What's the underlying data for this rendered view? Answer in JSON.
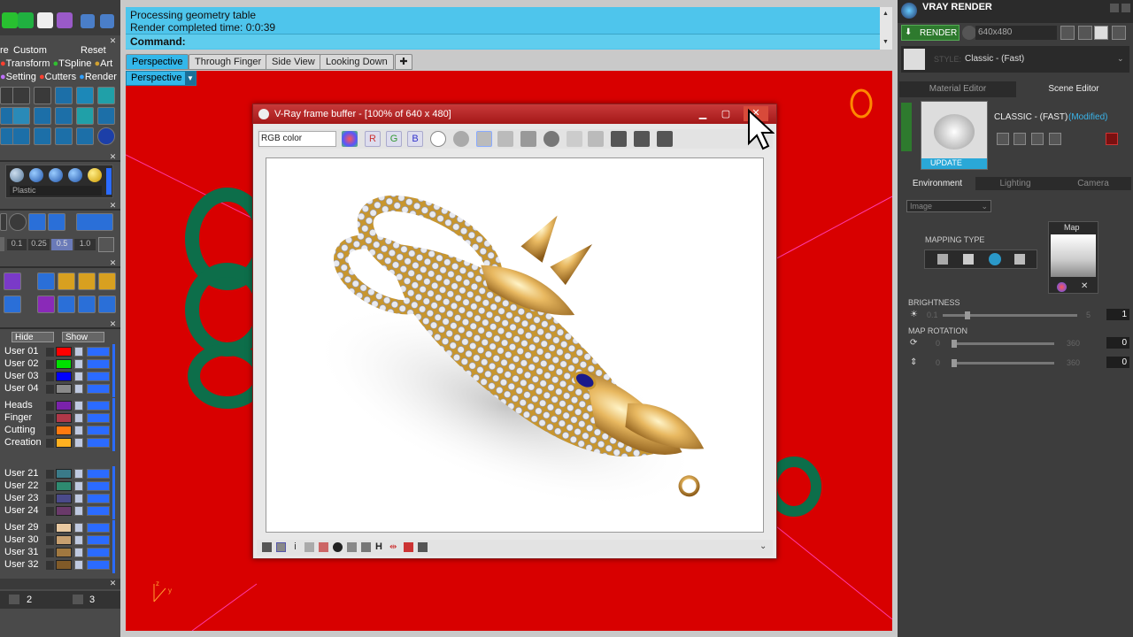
{
  "left_panel": {
    "tabs": {
      "custom": "Custom",
      "reset": "Reset",
      "prefix": "re"
    },
    "menu_row1": [
      "Transform",
      "TSpline",
      "Art"
    ],
    "menu_row2": [
      "Setting",
      "Cutters",
      "Render"
    ],
    "material_select": "Plastic",
    "snap_values": [
      "0.1",
      "0.25",
      "0.5",
      "1.0"
    ],
    "hide_label": "Hide",
    "show_label": "Show",
    "layers_group1": [
      {
        "name": "User 01",
        "color": "#ff0000"
      },
      {
        "name": "User 02",
        "color": "#00e000"
      },
      {
        "name": "User 03",
        "color": "#0000ff"
      },
      {
        "name": "User 04",
        "color": "#8a8a8a"
      }
    ],
    "layers_group2": [
      {
        "name": "Heads",
        "color": "#7a22aa"
      },
      {
        "name": "Finger",
        "color": "#b03848"
      },
      {
        "name": "Cutting",
        "color": "#ff7a10"
      },
      {
        "name": "Creation",
        "color": "#ffb020"
      }
    ],
    "layers_group3": [
      {
        "name": "User 21",
        "color": "#3a7a88"
      },
      {
        "name": "User 22",
        "color": "#2e8a70"
      },
      {
        "name": "User 23",
        "color": "#4a4a8a"
      },
      {
        "name": "User 24",
        "color": "#6a3a6a"
      }
    ],
    "layers_group4": [
      {
        "name": "User 29",
        "color": "#e8c8a0"
      },
      {
        "name": "User 30",
        "color": "#c8a070"
      },
      {
        "name": "User 31",
        "color": "#a07840"
      },
      {
        "name": "User 32",
        "color": "#805a28"
      }
    ],
    "page_nums": [
      "2",
      "3"
    ]
  },
  "command": {
    "line1": "Processing geometry table",
    "line2": "Render completed time: 0:0:39",
    "label": "Command:"
  },
  "viewport_tabs": [
    "Perspective",
    "Through Finger",
    "Side View",
    "Looking Down"
  ],
  "viewport_label": "Perspective",
  "vfb": {
    "title": "V-Ray frame buffer - [100% of 640 x 480]",
    "channel": "RGB color",
    "channels": [
      "R",
      "G",
      "B"
    ]
  },
  "right_panel": {
    "title": "VRAY RENDER",
    "render_button": "RENDER",
    "resolution": "640x480",
    "style_label": "STYLE:",
    "style_value": "Classic - (Fast)",
    "tabs": [
      "Material Editor",
      "Scene Editor"
    ],
    "preset_name": "CLASSIC - (FAST)",
    "preset_status": "(Modified)",
    "update_label": "UPDATE",
    "subtabs": [
      "Environment",
      "Lighting",
      "Camera"
    ],
    "env_type": "Image",
    "mapping_type": "MAPPING TYPE",
    "map_label": "Map",
    "brightness": {
      "label": "BRIGHTNESS",
      "min": "0.1",
      "max": "5",
      "value": "1"
    },
    "map_rotation": {
      "label": "MAP ROTATION",
      "row1": {
        "min": "0",
        "max": "360",
        "value": "0"
      },
      "row2": {
        "min": "0",
        "max": "360",
        "value": "0"
      }
    }
  },
  "colors": {
    "viewport_bg": "#d80000",
    "accent_blue": "#33b7ea",
    "command_bg": "#4ec5ec",
    "vray_green": "#2e7a2e"
  }
}
